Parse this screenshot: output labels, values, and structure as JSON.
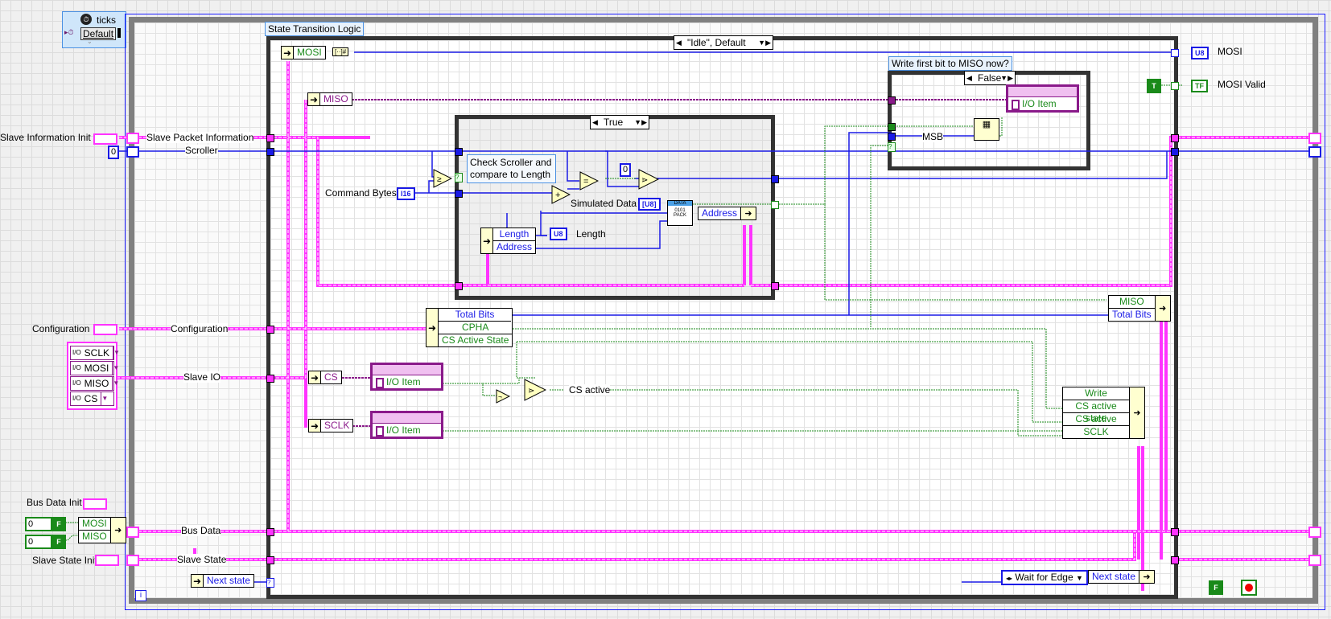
{
  "timing": {
    "label": "ticks",
    "source": "Default"
  },
  "left_controls": {
    "slave_info_init": "Slave Information Init",
    "scroller_const": "0",
    "configuration": "Configuration",
    "io_items": [
      "SCLK",
      "MOSI",
      "MISO",
      "CS"
    ],
    "bus_data_init": "Bus Data Init",
    "bus_numeric_values": [
      "0",
      "0"
    ],
    "bus_bool_values": [
      "F",
      "F"
    ],
    "bus_bundle_fields": [
      "MOSI",
      "MISO"
    ],
    "slave_state_init": "Slave State Init"
  },
  "shift_registers": {
    "slave_packet_info": "Slave  Packet Information",
    "scroller": "Scroller",
    "configuration": "Configuration",
    "slave_io": "Slave IO",
    "bus_data": "Bus Data",
    "slave_state": "Slave State"
  },
  "case_structure": {
    "label": "State Transition Logic",
    "selector": "\"Idle\", Default"
  },
  "unbundles": {
    "mosi": "MOSI",
    "miso": "MISO",
    "cs": "CS",
    "sclk": "SCLK",
    "length_address": [
      "Length",
      "Address"
    ],
    "configuration_fields": [
      "Total Bits",
      "CPHA",
      "CS Active State"
    ],
    "next_state": "Next state"
  },
  "inner_case": {
    "selector": "True",
    "comment": "Check Scroller and compare to Length",
    "command_bytes_label": "Command Bytes",
    "command_bytes_type": "I16",
    "zero_const": "0",
    "simulated_data_label": "Simulated Data",
    "simulated_data_type": "[U8]",
    "length_label": "Length",
    "length_type": "U8",
    "pack_node": {
      "top": "DATA",
      "mid": "0101",
      "bottom": "PACK"
    },
    "address_bundle": "Address"
  },
  "miso_case": {
    "label": "Write first bit to MISO now?",
    "selector": "False",
    "msb_label": "MSB",
    "io_item": "I/O Item"
  },
  "outputs": {
    "mosi_label": "MOSI",
    "mosi_type": "U8",
    "mosi_valid_label": "MOSI Valid",
    "mosi_valid_type": "TF",
    "true_const": "T"
  },
  "io_nodes": {
    "cs_item": "I/O Item",
    "sclk_item": "I/O Item"
  },
  "cs_active_label": "CS active",
  "bundles": {
    "miso_totalbits": [
      "MISO",
      "Total Bits"
    ],
    "state_fields": [
      "Write",
      "CS active state",
      "CS active",
      "SCLK"
    ],
    "next_state": "Next state"
  },
  "enum_const": "Wait for Edge",
  "stop_const": "F",
  "info_icon": "i",
  "colors": {
    "cluster_wire": "#ff33ff",
    "numeric_wire": "#1a1ae6",
    "boolean_wire": "#1a8a1a",
    "ioref_wire": "#8a1a8a",
    "loop_border": "#808080"
  }
}
